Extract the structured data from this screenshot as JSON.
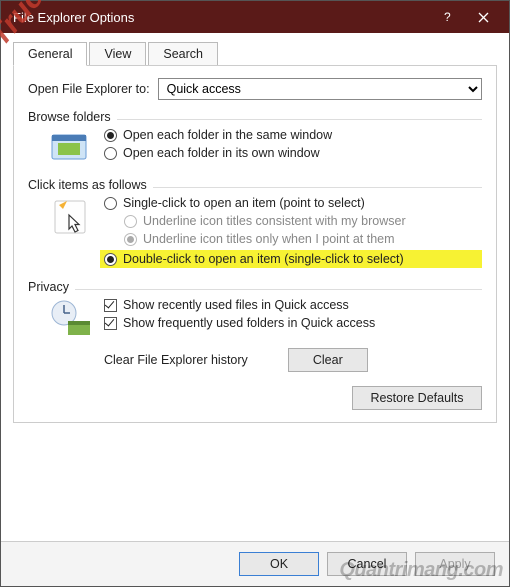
{
  "titlebar": {
    "title": "File Explorer Options"
  },
  "tabs": {
    "general": "General",
    "view": "View",
    "search": "Search"
  },
  "open_to": {
    "label": "Open File Explorer to:",
    "value": "Quick access"
  },
  "browse": {
    "title": "Browse folders",
    "same": "Open each folder in the same window",
    "own": "Open each folder in its own window"
  },
  "click": {
    "title": "Click items as follows",
    "single": "Single-click to open an item (point to select)",
    "underline_browser": "Underline icon titles consistent with my browser",
    "underline_point": "Underline icon titles only when I point at them",
    "double": "Double-click to open an item (single-click to select)"
  },
  "privacy": {
    "title": "Privacy",
    "recent_files": "Show recently used files in Quick access",
    "frequent_folders": "Show frequently used folders in Quick access",
    "clear_label": "Clear File Explorer history",
    "clear_btn": "Clear"
  },
  "restore": "Restore Defaults",
  "footer": {
    "ok": "OK",
    "cancel": "Cancel",
    "apply": "Apply"
  },
  "watermarks": {
    "top": "Truongtin.top",
    "bottom": "Quantrimang.com"
  }
}
